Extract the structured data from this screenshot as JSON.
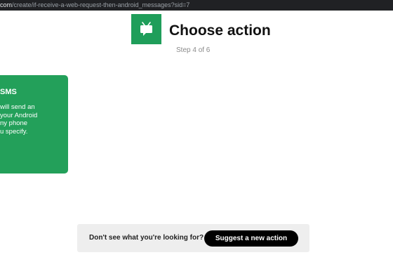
{
  "browser": {
    "url_host": "com",
    "url_path": "/create/if-receive-a-web-request-then-android_messages?sid=7"
  },
  "header": {
    "app_icon": "android-sms-icon",
    "title": "Choose action",
    "step": "Step 4 of 6"
  },
  "card": {
    "title": "SMS",
    "description_lines": [
      "will send an",
      "your Android",
      "ny phone",
      "u specify."
    ]
  },
  "suggest": {
    "prompt": "Don't see what you're looking for?",
    "button_label": "Suggest a new action"
  },
  "colors": {
    "brand_green": "#23a05a",
    "button_black": "#000000",
    "panel_gray": "#eeeeee",
    "browser_bar": "#202124"
  }
}
